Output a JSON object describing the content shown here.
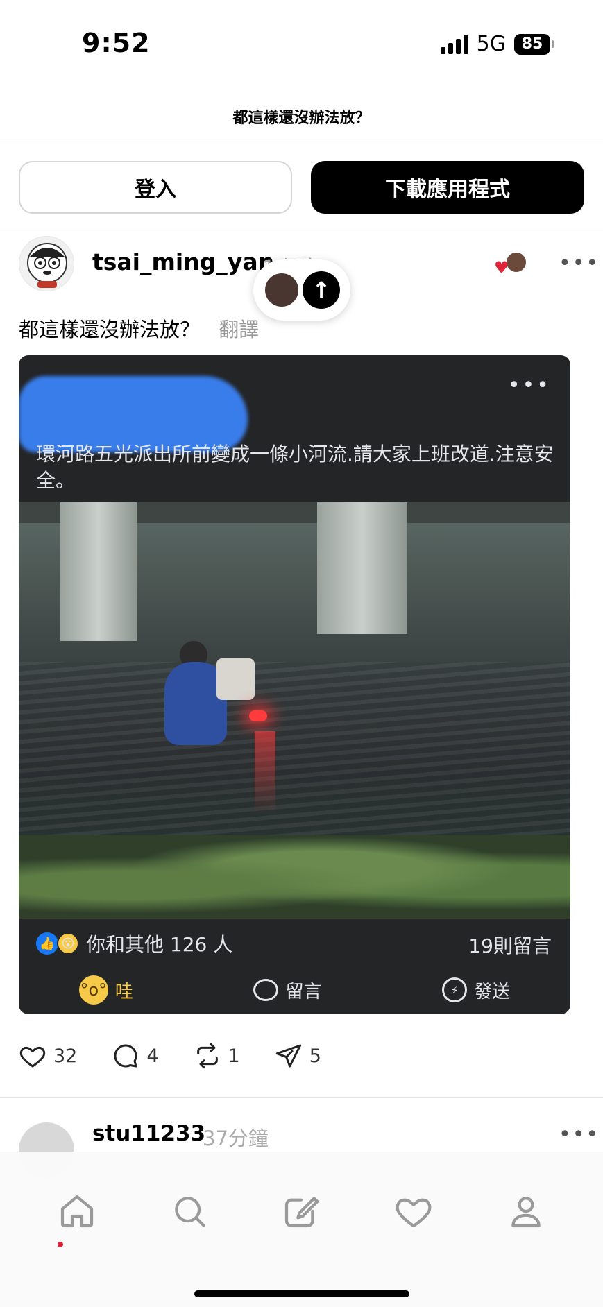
{
  "status_bar": {
    "time": "9:52",
    "network": "5G",
    "battery": "85"
  },
  "header": {
    "title": "都這樣還沒辦法放？"
  },
  "buttons": {
    "login": "登入",
    "download": "下載應用程式"
  },
  "post": {
    "username": "tsai_ming_yan",
    "time": "1小時",
    "caption": "都這樣還沒辦法放？",
    "translate": "翻譯",
    "embed": {
      "text": "環河路五光派出所前變成一條小河流.請大家上班改道.注意安全。",
      "reactions_text": "你和其他 126 人",
      "comments_text": "19則留言",
      "actions": {
        "wow": "哇",
        "comment": "留言",
        "send": "發送"
      }
    },
    "stats": {
      "likes": "32",
      "replies": "4",
      "reposts": "1",
      "shares": "5"
    }
  },
  "next_post": {
    "username": "stu11233",
    "time": "37分鐘"
  },
  "colors": {
    "accent": "#000000",
    "fb_card_bg": "#242526",
    "wow_yellow": "#f7c948",
    "heart_red": "#e0243a"
  },
  "icons": {
    "nav": [
      "home-icon",
      "search-icon",
      "compose-icon",
      "heart-icon",
      "profile-icon"
    ],
    "actions": [
      "heart-icon",
      "reply-icon",
      "repost-icon",
      "share-icon"
    ]
  }
}
